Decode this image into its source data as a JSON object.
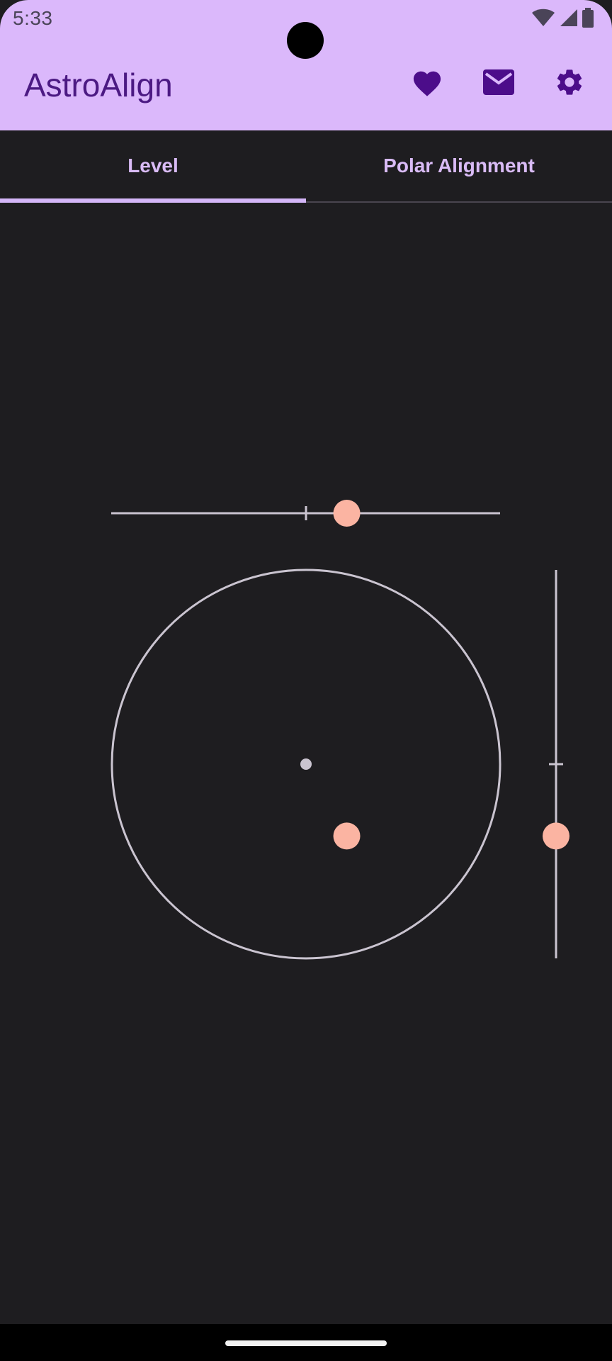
{
  "status_bar": {
    "time": "5:33",
    "icons": [
      "wifi-icon",
      "cell-signal-icon",
      "battery-icon"
    ]
  },
  "app_bar": {
    "title": "AstroAlign",
    "actions": [
      "heart-icon",
      "mail-icon",
      "gear-icon"
    ],
    "background": "#dbb8fb",
    "title_color": "#4c1a83"
  },
  "tabs": [
    {
      "label": "Level",
      "selected": true
    },
    {
      "label": "Polar Alignment",
      "selected": false
    }
  ],
  "level": {
    "horizontal_tilt": 0.21,
    "vertical_tilt": 0.37,
    "bubble_color": "#fbb4a2",
    "guide_color": "#cac4d0"
  }
}
